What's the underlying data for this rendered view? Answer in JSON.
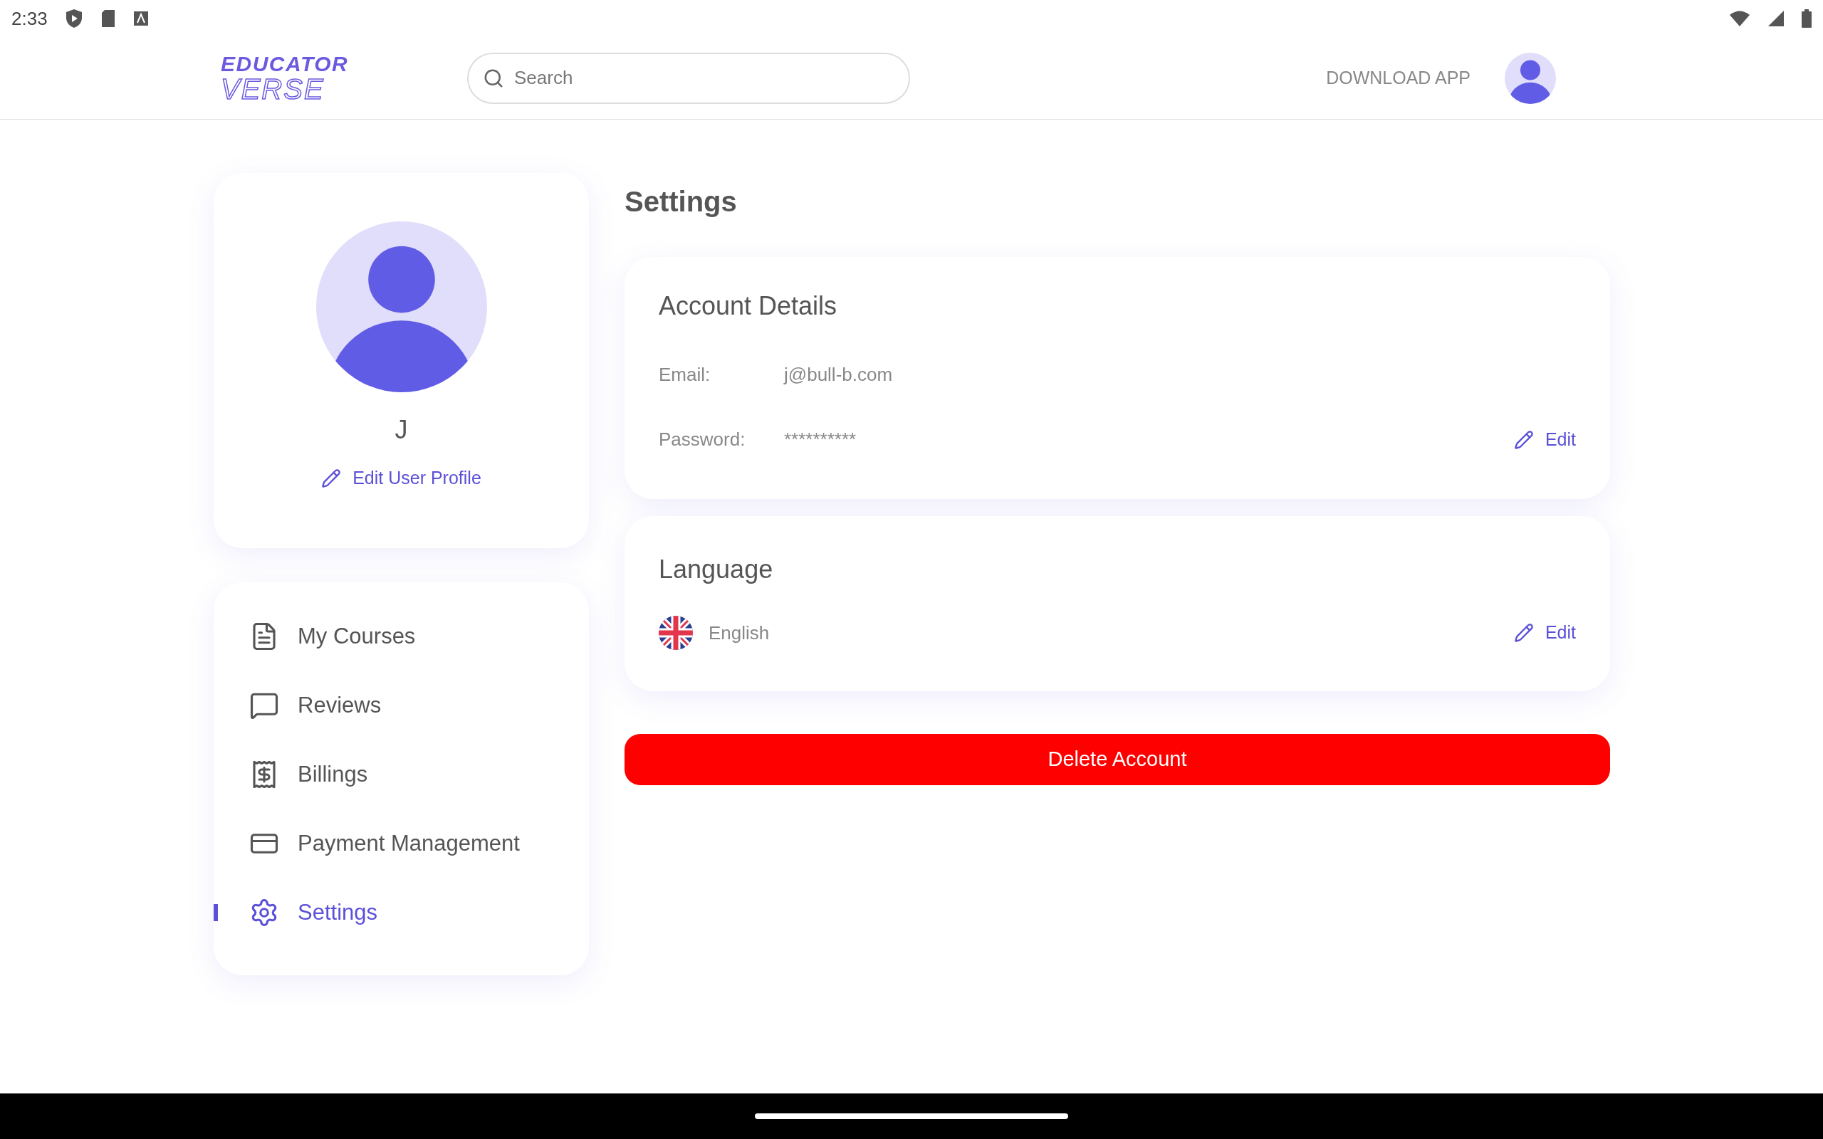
{
  "status_bar": {
    "time": "2:33"
  },
  "header": {
    "logo": [
      "EDUCATOR",
      "VERSE"
    ],
    "search": {
      "placeholder": "Search"
    },
    "download": "DOWNLOAD APP"
  },
  "profile": {
    "name": "J",
    "edit": "Edit User Profile"
  },
  "nav": [
    {
      "label": "My Courses",
      "kind": "courses",
      "selected": false
    },
    {
      "label": "Reviews",
      "kind": "reviews",
      "selected": false
    },
    {
      "label": "Billings",
      "kind": "billings",
      "selected": false
    },
    {
      "label": "Payment Management",
      "kind": "payment",
      "selected": false
    },
    {
      "label": "Settings",
      "kind": "settings",
      "selected": true
    }
  ],
  "page_title": "Settings",
  "account": {
    "title": "Account Details",
    "rows": [
      {
        "label": "Email:",
        "value": "j@bull-b.com"
      },
      {
        "label": "Password:",
        "value": "**********"
      }
    ],
    "edit": "Edit"
  },
  "language": {
    "title": "Language",
    "value": "English",
    "edit": "Edit"
  },
  "delete_button": "Delete Account"
}
